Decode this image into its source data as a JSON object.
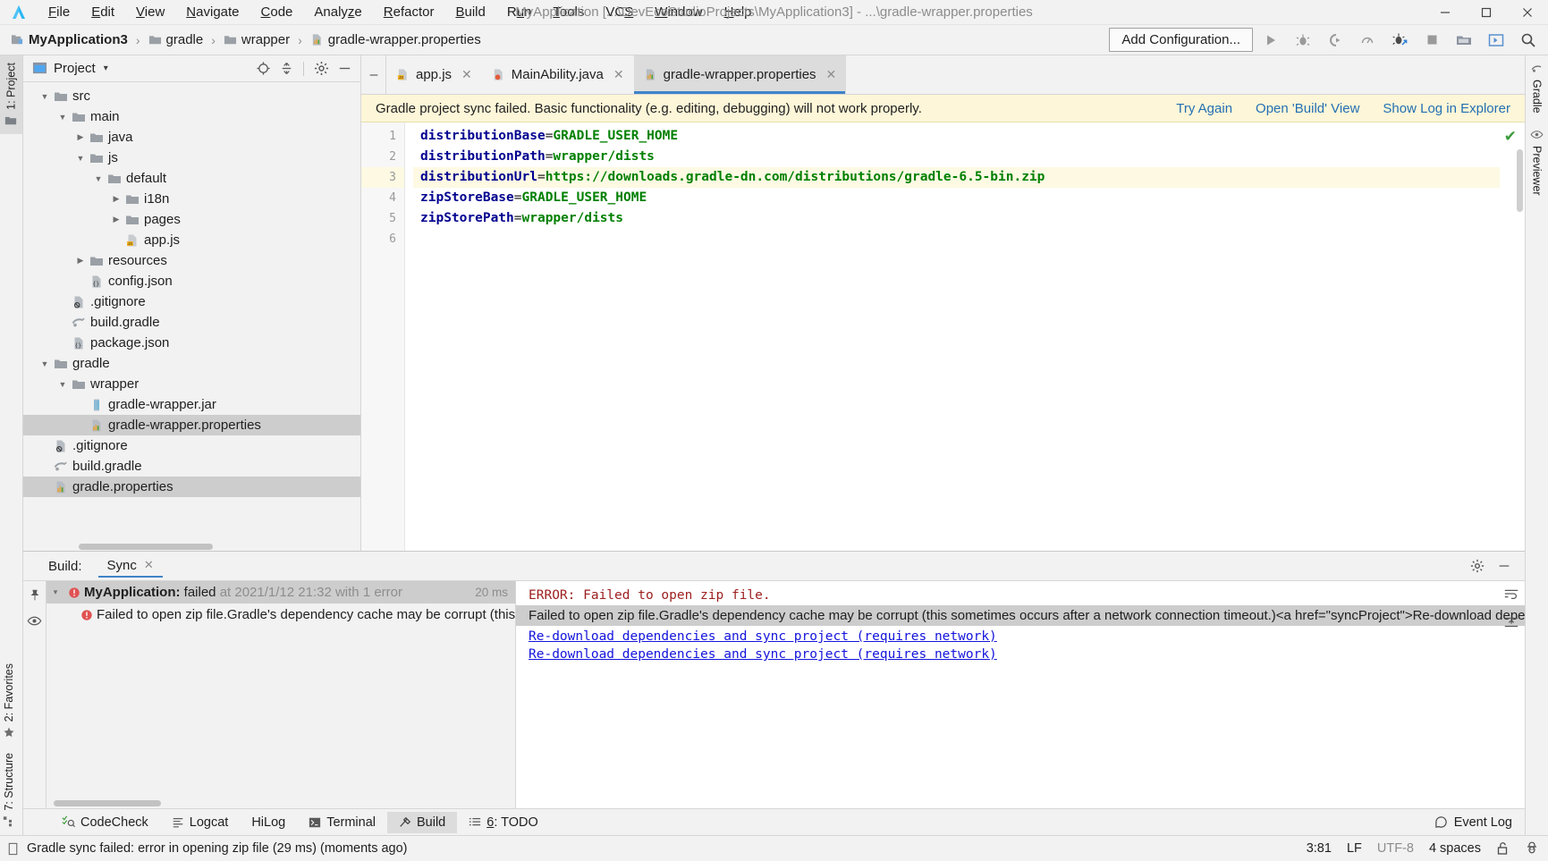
{
  "window": {
    "title": "MyApplication [...\\DevEcoStudioProjects\\MyApplication3] - ...\\gradle-wrapper.properties",
    "minimize": "–",
    "maximize": "☐",
    "close": "✕"
  },
  "menu": {
    "items": [
      {
        "label": "File"
      },
      {
        "label": "Edit"
      },
      {
        "label": "View"
      },
      {
        "label": "Navigate"
      },
      {
        "label": "Code"
      },
      {
        "label": "Analyze"
      },
      {
        "label": "Refactor"
      },
      {
        "label": "Build"
      },
      {
        "label": "Run"
      },
      {
        "label": "Tools"
      },
      {
        "label": "VCS"
      },
      {
        "label": "Window"
      },
      {
        "label": "Help"
      }
    ]
  },
  "breadcrumb": {
    "items": [
      {
        "label": "MyApplication3",
        "icon": "module-icon"
      },
      {
        "label": "gradle",
        "icon": "folder-icon"
      },
      {
        "label": "wrapper",
        "icon": "folder-icon"
      },
      {
        "label": "gradle-wrapper.properties",
        "icon": "properties-file-icon"
      }
    ],
    "separator": "›"
  },
  "toolbar": {
    "add_configuration": "Add Configuration...",
    "icons": [
      "run-icon",
      "debug-icon",
      "run-coverage-icon",
      "profile-icon",
      "attach-debugger-icon",
      "stop-icon",
      "device-manager-icon",
      "device-file-explorer-icon",
      "search-everywhere-icon"
    ]
  },
  "left_rail": {
    "top": [
      {
        "label": "1: Project",
        "icon": "project-icon",
        "selected": true
      }
    ],
    "bottom": [
      {
        "label": "2: Favorites",
        "icon": "star-icon",
        "selected": false
      },
      {
        "label": "7: Structure",
        "icon": "structure-icon",
        "selected": false
      }
    ]
  },
  "right_rail": {
    "items": [
      {
        "label": "Gradle",
        "icon": "gradle-icon"
      },
      {
        "label": "Previewer",
        "icon": "eye-icon"
      }
    ]
  },
  "project_panel": {
    "title": "Project",
    "dropdown_caret": "▾",
    "actions": [
      "locate-icon",
      "collapse-all-icon",
      "settings-gear-icon",
      "hide-icon"
    ],
    "tree": [
      {
        "indent": 2,
        "arrow": "down",
        "icon": "folder-icon",
        "label": "src",
        "selected": false
      },
      {
        "indent": 3,
        "arrow": "down",
        "icon": "folder-icon",
        "label": "main",
        "selected": false
      },
      {
        "indent": 4,
        "arrow": "right",
        "icon": "folder-icon",
        "label": "java",
        "selected": false
      },
      {
        "indent": 4,
        "arrow": "down",
        "icon": "folder-icon",
        "label": "js",
        "selected": false
      },
      {
        "indent": 5,
        "arrow": "down",
        "icon": "folder-icon",
        "label": "default",
        "selected": false
      },
      {
        "indent": 6,
        "arrow": "right",
        "icon": "folder-icon",
        "label": "i18n",
        "selected": false
      },
      {
        "indent": 6,
        "arrow": "right",
        "icon": "folder-icon",
        "label": "pages",
        "selected": false
      },
      {
        "indent": 6,
        "arrow": "none",
        "icon": "js-file-icon",
        "label": "app.js",
        "selected": false
      },
      {
        "indent": 4,
        "arrow": "right",
        "icon": "folder-icon",
        "label": "resources",
        "selected": false
      },
      {
        "indent": 4,
        "arrow": "none",
        "icon": "json-file-icon",
        "label": "config.json",
        "selected": false
      },
      {
        "indent": 3,
        "arrow": "none",
        "icon": "gitignore-icon",
        "label": ".gitignore",
        "selected": false
      },
      {
        "indent": 3,
        "arrow": "none",
        "icon": "gradle-file-icon",
        "label": "build.gradle",
        "selected": false
      },
      {
        "indent": 3,
        "arrow": "none",
        "icon": "json-file-icon",
        "label": "package.json",
        "selected": false
      },
      {
        "indent": 2,
        "arrow": "down",
        "icon": "folder-icon",
        "label": "gradle",
        "selected": false
      },
      {
        "indent": 3,
        "arrow": "down",
        "icon": "folder-icon",
        "label": "wrapper",
        "selected": false
      },
      {
        "indent": 4,
        "arrow": "none",
        "icon": "jar-file-icon",
        "label": "gradle-wrapper.jar",
        "selected": false
      },
      {
        "indent": 4,
        "arrow": "none",
        "icon": "properties-file-icon",
        "label": "gradle-wrapper.properties",
        "selected": true
      },
      {
        "indent": 2,
        "arrow": "none",
        "icon": "gitignore-icon",
        "label": ".gitignore",
        "selected": false
      },
      {
        "indent": 2,
        "arrow": "none",
        "icon": "gradle-file-icon",
        "label": "build.gradle",
        "selected": false
      },
      {
        "indent": 2,
        "arrow": "none",
        "icon": "properties-file-icon",
        "label": "gradle.properties",
        "selected": true
      }
    ]
  },
  "editor": {
    "tabs": [
      {
        "label": "app.js",
        "icon": "js-file-icon",
        "active": false,
        "close": "✕"
      },
      {
        "label": "MainAbility.java",
        "icon": "java-file-icon",
        "active": false,
        "close": "✕"
      },
      {
        "label": "gradle-wrapper.properties",
        "icon": "properties-file-icon",
        "active": true,
        "close": "✕"
      }
    ],
    "notification": {
      "message": "Gradle project sync failed. Basic functionality (e.g. editing, debugging) will not work properly.",
      "links": [
        "Try Again",
        "Open 'Build' View",
        "Show Log in Explorer"
      ]
    },
    "lines": [
      {
        "num": "1",
        "key": "distributionBase",
        "eq": "=",
        "value": "GRADLE_USER_HOME",
        "highlight": false
      },
      {
        "num": "2",
        "key": "distributionPath",
        "eq": "=",
        "value": "wrapper/dists",
        "highlight": false
      },
      {
        "num": "3",
        "key": "distributionUrl",
        "eq": "=",
        "value": "https://downloads.gradle-dn.com/distributions/gradle-6.5-bin.zip",
        "highlight": true
      },
      {
        "num": "4",
        "key": "zipStoreBase",
        "eq": "=",
        "value": "GRADLE_USER_HOME",
        "highlight": false
      },
      {
        "num": "5",
        "key": "zipStorePath",
        "eq": "=",
        "value": "wrapper/dists",
        "highlight": false
      },
      {
        "num": "6",
        "key": "",
        "eq": "",
        "value": "",
        "highlight": false
      }
    ],
    "inspection_status": "✔"
  },
  "build_panel": {
    "label": "Build:",
    "tab": "Sync",
    "tab_close": "✕",
    "actions": [
      "settings-gear-icon",
      "hide-icon"
    ],
    "rail_icons": [
      "pin-icon",
      "eye-icon"
    ],
    "tree": [
      {
        "arrow": "▾",
        "title_bold": "MyApplication:",
        "title_rest": " failed",
        "meta": " at 2021/1/12 21:32 with 1 error",
        "duration": "20 ms",
        "selected": true,
        "icon": "error-icon"
      },
      {
        "arrow": "",
        "title_bold": "",
        "title_rest": "Failed to open zip file.Gradle's dependency cache may be corrupt (this sometimes occurs after a network connection timeout.)",
        "meta": "",
        "duration": "",
        "selected": false,
        "icon": "error-icon"
      }
    ],
    "detail": {
      "error_line": "ERROR: Failed to open zip file.",
      "banner": "Failed to open zip file.Gradle's dependency cache may be corrupt (this sometimes occurs after a network connection timeout.)<a href=\"syncProject\">Re-download dependencies and sync project (requires network)</a>",
      "links": [
        "Re-download dependencies and sync project (requires network)",
        "Re-download dependencies and sync project (requires network)"
      ],
      "actions": [
        "soft-wrap-icon",
        "scroll-end-icon"
      ]
    }
  },
  "tool_window_bar": {
    "items": [
      {
        "label": "CodeCheck",
        "icon": "codecheck-icon",
        "selected": false
      },
      {
        "label": "Logcat",
        "icon": "logcat-icon",
        "selected": false
      },
      {
        "label": "HiLog",
        "icon": "",
        "selected": false
      },
      {
        "label": "Terminal",
        "icon": "terminal-icon",
        "selected": false
      },
      {
        "label": "Build",
        "icon": "build-hammer-icon",
        "selected": true
      },
      {
        "label": "6: TODO",
        "icon": "todo-icon",
        "selected": false
      }
    ],
    "event_log": "Event Log",
    "event_log_icon": "event-log-icon"
  },
  "status_bar": {
    "message": "Gradle sync failed: error in opening zip file (29 ms) (moments ago)",
    "message_icon": "notification-icon",
    "caret_position": "3:81",
    "line_separator": "LF",
    "encoding": "UTF-8",
    "indent": "4 spaces",
    "lock_icon": "unlocked-icon",
    "inspector_icon": "hector-icon"
  },
  "colors": {
    "accent": "#4083c9",
    "notification_bg": "#fdf6d8",
    "link": "#2470b3",
    "error": "#9d2020",
    "code_key": "#00008f",
    "code_value": "#008000"
  }
}
